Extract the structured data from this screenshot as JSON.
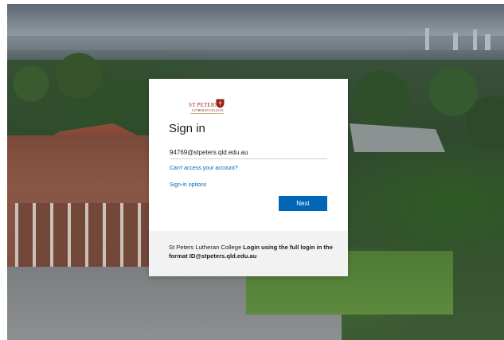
{
  "org": {
    "logo_name": "ST PETERS",
    "logo_sub": "LUTHERAN COLLEGE",
    "brand_color": "#9b1c1c"
  },
  "signin": {
    "title": "Sign in",
    "email": "94769@stpeters.qld.edu.au",
    "cant_access": "Can't access your account?",
    "options": "Sign-in options",
    "next_label": "Next",
    "accent": "#0067b8"
  },
  "footer": {
    "prefix": "St Peters Lutheran College ",
    "bold": "Login using the full login in the format ID@stpeters.qld.edu.au"
  }
}
